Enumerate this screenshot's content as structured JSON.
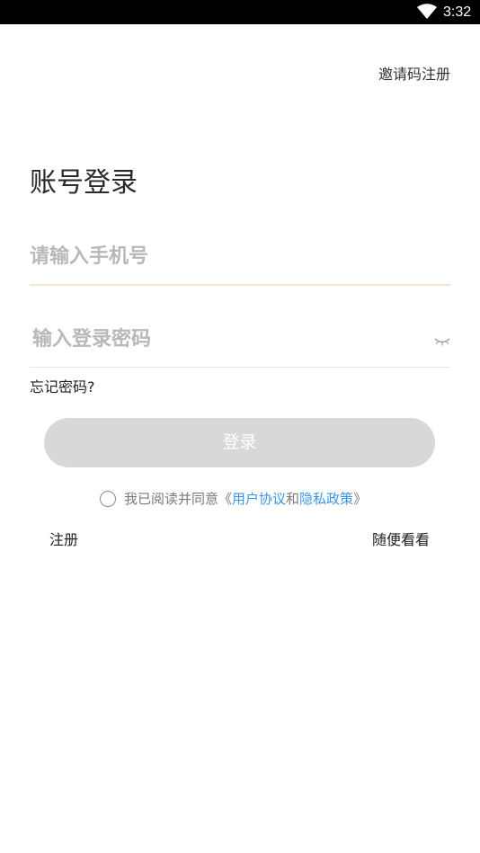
{
  "status_bar": {
    "time": "3:32",
    "wifi_icon": "wifi-icon"
  },
  "header": {
    "invite_register": "邀请码注册"
  },
  "login": {
    "title": "账号登录",
    "phone_placeholder": "请输入手机号",
    "phone_value": "",
    "password_placeholder": "输入登录密码",
    "password_value": "",
    "password_toggle_icon": "eye-closed-icon",
    "forgot_password": "忘记密码?",
    "login_button": "登录",
    "login_button_color": "#d8d8d8"
  },
  "agreement": {
    "checked": false,
    "prefix": "我已阅读并同意《",
    "user_agreement": "用户协议",
    "and": "和",
    "privacy_policy": "隐私政策",
    "suffix": "》",
    "link_color": "#3a95e8"
  },
  "footer": {
    "register": "注册",
    "browse": "随便看看"
  }
}
